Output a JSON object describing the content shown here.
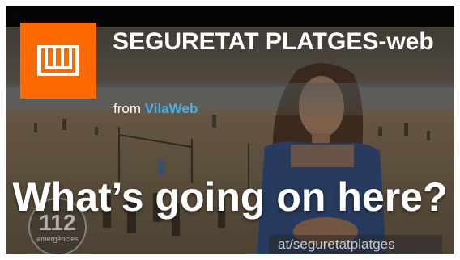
{
  "video": {
    "title": "SEGURETAT PLATGES-web",
    "byline_prefix": "from",
    "channel": "VilaWeb",
    "badge_number": "112",
    "badge_word": "emergències",
    "url_text": "at/seguretatplatges"
  },
  "caption": {
    "text": "What’s going on here?"
  },
  "colors": {
    "logo_bg": "#ff6a00",
    "channel_link": "#43b1ef"
  },
  "icons": {
    "logo": "vilaweb-logo-icon"
  }
}
